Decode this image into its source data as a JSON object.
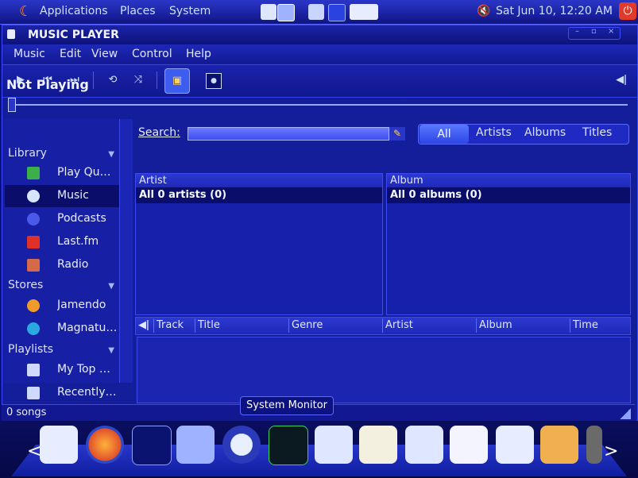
{
  "top_panel": {
    "menus": [
      "Applications",
      "Places",
      "System"
    ],
    "clock": "Sat Jun 10, 12:20 AM"
  },
  "window": {
    "title": "MUSIC PLAYER",
    "menubar": [
      "Music",
      "Edit",
      "View",
      "Control",
      "Help"
    ],
    "now_playing": "Not Playing",
    "win_controls": [
      "–",
      "▫",
      "×"
    ]
  },
  "sidebar": {
    "sections": [
      {
        "label": "Library"
      },
      {
        "label": "Stores"
      },
      {
        "label": "Playlists"
      }
    ],
    "items": [
      {
        "label": "Play Qu…",
        "icon": "queue-icon"
      },
      {
        "label": "Music",
        "icon": "music-icon"
      },
      {
        "label": "Podcasts",
        "icon": "podcast-icon"
      },
      {
        "label": "Last.fm",
        "icon": "lastfm-icon"
      },
      {
        "label": "Radio",
        "icon": "radio-icon"
      },
      {
        "label": "Jamendo",
        "icon": "jamendo-icon"
      },
      {
        "label": "Magnatu…",
        "icon": "magnatune-icon"
      },
      {
        "label": "My Top …",
        "icon": "playlist-icon"
      },
      {
        "label": "Recently…",
        "icon": "playlist-icon"
      }
    ]
  },
  "search": {
    "label": "Search:",
    "value": "",
    "filters": [
      "All",
      "Artists",
      "Albums",
      "Titles"
    ]
  },
  "browser": {
    "artist_header": "Artist",
    "artist_row": "All 0 artists (0)",
    "album_header": "Album",
    "album_row": "All 0 albums (0)"
  },
  "tracks": {
    "columns": [
      "Track",
      "Title",
      "Genre",
      "Artist",
      "Album",
      "Time"
    ]
  },
  "status": {
    "song_count": "0 songs"
  },
  "tooltip": "System Monitor",
  "colors": {
    "accent": "#2b45e4",
    "selection": "#0a0e6a",
    "background": "#141d9a"
  }
}
